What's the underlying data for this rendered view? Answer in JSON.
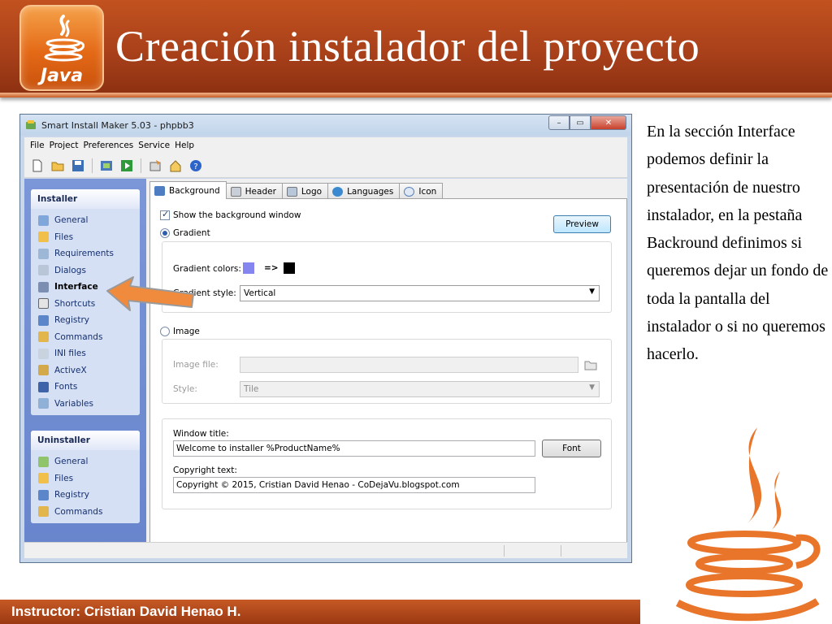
{
  "slide": {
    "title": "Creación instalador del proyecto",
    "logo_text": "Java",
    "explanation": "En la sección Interface podemos definir la presentación de nuestro instalador, en la pestaña Backround definimos si queremos dejar un fondo de toda la pantalla del instalador o si no queremos hacerlo.",
    "footer": "Instructor: Cristian David Henao H."
  },
  "app": {
    "title": "Smart Install Maker 5.03 - phpbb3",
    "window_controls": {
      "minimize": "–",
      "maximize": "▭",
      "close": "✕"
    },
    "menu": [
      "File",
      "Project",
      "Preferences",
      "Service",
      "Help"
    ],
    "toolbar_icons": [
      "new-file-icon",
      "open-folder-icon",
      "save-icon",
      "build-icon",
      "run-icon",
      "options-icon",
      "wizard-icon",
      "help-icon"
    ],
    "installer_group": {
      "header": "Installer",
      "items": [
        "General",
        "Files",
        "Requirements",
        "Dialogs",
        "Interface",
        "Shortcuts",
        "Registry",
        "Commands",
        "INI files",
        "ActiveX",
        "Fonts",
        "Variables"
      ],
      "active": "Interface"
    },
    "uninstaller_group": {
      "header": "Uninstaller",
      "items": [
        "General",
        "Files",
        "Registry",
        "Commands"
      ]
    },
    "tabs": [
      "Background",
      "Header",
      "Logo",
      "Languages",
      "Icon"
    ],
    "active_tab": "Background",
    "background": {
      "show_window_label": "Show the background window",
      "show_window_checked": true,
      "preview_label": "Preview",
      "gradient_label": "Gradient",
      "gradient_selected": true,
      "gradient_colors_label": "Gradient colors:",
      "gradient_arrow": "=>",
      "gradient_color_from": "#8585f0",
      "gradient_color_to": "#000000",
      "gradient_style_label": "Gradient style:",
      "gradient_style_value": "Vertical",
      "image_label": "Image",
      "image_file_label": "Image file:",
      "image_file_value": "",
      "style_label": "Style:",
      "style_value": "Tile",
      "window_title_label": "Window title:",
      "window_title_value": "Welcome to installer %ProductName%",
      "font_button": "Font",
      "copyright_label": "Copyright text:",
      "copyright_value": "Copyright © 2015, Cristian David Henao - CoDejaVu.blogspot.com"
    }
  },
  "colors": {
    "header_brown": "#a8401a",
    "java_orange": "#e46a17",
    "nav_blue": "#6f8bd1",
    "highlight_arrow": "#f08a3c"
  }
}
